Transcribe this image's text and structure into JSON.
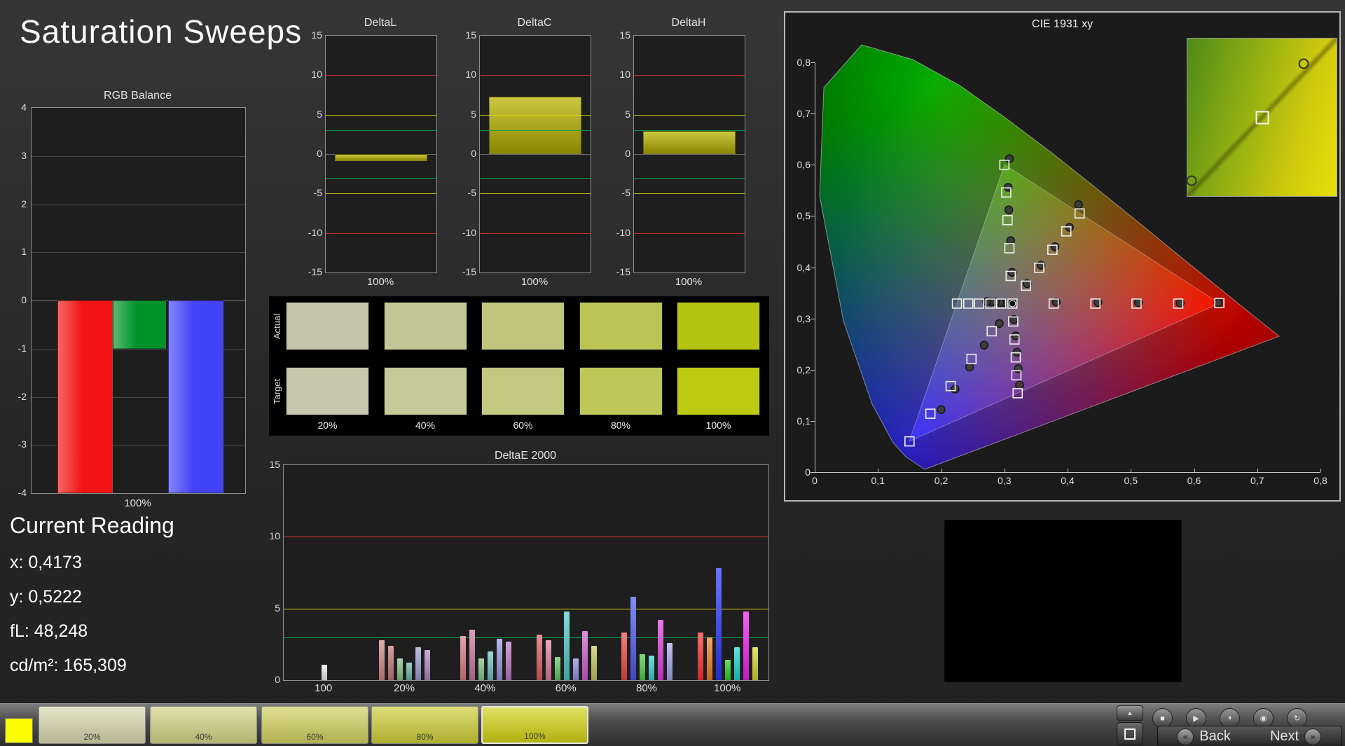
{
  "page": {
    "title": "Saturation Sweeps"
  },
  "rgb_balance": {
    "title": "RGB Balance",
    "xlabel": "100%",
    "ylim": [
      -4,
      4
    ],
    "yticks": [
      4,
      3,
      2,
      1,
      0,
      -1,
      -2,
      -3,
      -4
    ],
    "bars": [
      {
        "name": "red",
        "value": -4,
        "color": "#f21414"
      },
      {
        "name": "green",
        "value": -1,
        "color": "#00932a"
      },
      {
        "name": "blue",
        "value": -4,
        "color": "#4343fa"
      }
    ]
  },
  "delta_charts": {
    "ylim": [
      -15,
      15
    ],
    "yticks": [
      15,
      10,
      5,
      0,
      -5,
      -10,
      -15
    ],
    "xlabel": "100%",
    "bar_color": "#b9b400",
    "ref_lines": [
      {
        "v": 10,
        "color": "#e03232"
      },
      {
        "v": 5,
        "color": "#d6d600"
      },
      {
        "v": 3,
        "color": "#00a850"
      },
      {
        "v": -3,
        "color": "#00a850"
      },
      {
        "v": -5,
        "color": "#d6d600"
      },
      {
        "v": -10,
        "color": "#e03232"
      }
    ],
    "charts": [
      {
        "title": "DeltaL",
        "value": -0.9
      },
      {
        "title": "DeltaC",
        "value": 7.3
      },
      {
        "title": "DeltaH",
        "value": 2.9
      }
    ]
  },
  "swatch_table": {
    "row_labels": [
      "Actual",
      "Target"
    ],
    "columns": [
      "20%",
      "40%",
      "60%",
      "80%",
      "100%"
    ],
    "actual": [
      "#c3c4a9",
      "#c3c795",
      "#bfc67c",
      "#bcc553",
      "#b4c40f"
    ],
    "target": [
      "#c7c8ad",
      "#c6c999",
      "#c3c981",
      "#bfc757",
      "#bccb12"
    ]
  },
  "deltae": {
    "title": "DeltaE 2000",
    "ylim": [
      0,
      15
    ],
    "yticks": [
      15,
      10,
      5,
      0
    ],
    "ref_lines": [
      {
        "v": 10,
        "color": "#e03232"
      },
      {
        "v": 5,
        "color": "#d6d600"
      },
      {
        "v": 3,
        "color": "#00a850"
      }
    ],
    "groups": [
      {
        "label": "100",
        "bars": [
          {
            "color": "#f0f0f0",
            "value": 1.1
          }
        ]
      },
      {
        "label": "20%",
        "bars": [
          {
            "color": "#d4888c",
            "value": 2.8
          },
          {
            "color": "#c47878",
            "value": 2.4
          },
          {
            "color": "#8cc08c",
            "value": 1.5
          },
          {
            "color": "#70b8b0",
            "value": 1.2
          },
          {
            "color": "#a0a0d8",
            "value": 2.3
          },
          {
            "color": "#b888c0",
            "value": 2.1
          }
        ]
      },
      {
        "label": "40%",
        "bars": [
          {
            "color": "#d87e84",
            "value": 3.1
          },
          {
            "color": "#c877a0",
            "value": 3.5
          },
          {
            "color": "#84c884",
            "value": 1.5
          },
          {
            "color": "#6cc4c4",
            "value": 2.0
          },
          {
            "color": "#9898e0",
            "value": 2.9
          },
          {
            "color": "#c078c8",
            "value": 2.7
          }
        ]
      },
      {
        "label": "60%",
        "bars": [
          {
            "color": "#e06060",
            "value": 3.2
          },
          {
            "color": "#e080a0",
            "value": 2.8
          },
          {
            "color": "#60c860",
            "value": 1.6
          },
          {
            "color": "#50c8c8",
            "value": 4.8
          },
          {
            "color": "#9090e8",
            "value": 1.5
          },
          {
            "color": "#d060d0",
            "value": 3.4
          },
          {
            "color": "#c8c860",
            "value": 2.4
          }
        ]
      },
      {
        "label": "80%",
        "bars": [
          {
            "color": "#f04848",
            "value": 3.3
          },
          {
            "color": "#5058f0",
            "value": 5.8
          },
          {
            "color": "#48d048",
            "value": 1.8
          },
          {
            "color": "#40d0d0",
            "value": 1.7
          },
          {
            "color": "#e040e0",
            "value": 4.2
          },
          {
            "color": "#a8a8f0",
            "value": 2.6
          }
        ]
      },
      {
        "label": "100%",
        "bars": [
          {
            "color": "#ff3030",
            "value": 3.3
          },
          {
            "color": "#f08030",
            "value": 3.0
          },
          {
            "color": "#2838ff",
            "value": 7.8
          },
          {
            "color": "#28d028",
            "value": 1.4
          },
          {
            "color": "#20d8d8",
            "value": 2.3
          },
          {
            "color": "#f020f0",
            "value": 4.8
          },
          {
            "color": "#d8d830",
            "value": 2.3
          }
        ]
      }
    ]
  },
  "cie": {
    "title": "CIE 1931 xy",
    "xticks": [
      "0",
      "0,1",
      "0,2",
      "0,3",
      "0,4",
      "0,5",
      "0,6",
      "0,7",
      "0,8"
    ],
    "yticks": [
      "0,8",
      "0,7",
      "0,6",
      "0,5",
      "0,4",
      "0,3",
      "0,2",
      "0,1",
      "0"
    ],
    "triangle": [
      [
        0.64,
        0.33
      ],
      [
        0.3,
        0.6
      ],
      [
        0.15,
        0.06
      ]
    ],
    "targets": [
      [
        0.3127,
        0.329
      ],
      [
        0.378,
        0.329
      ],
      [
        0.444,
        0.329
      ],
      [
        0.509,
        0.329
      ],
      [
        0.575,
        0.329
      ],
      [
        0.64,
        0.33
      ],
      [
        0.31,
        0.383
      ],
      [
        0.308,
        0.437
      ],
      [
        0.305,
        0.492
      ],
      [
        0.303,
        0.546
      ],
      [
        0.3,
        0.6
      ],
      [
        0.28,
        0.275
      ],
      [
        0.248,
        0.221
      ],
      [
        0.215,
        0.168
      ],
      [
        0.183,
        0.114
      ],
      [
        0.15,
        0.06
      ],
      [
        0.295,
        0.329
      ],
      [
        0.278,
        0.329
      ],
      [
        0.26,
        0.329
      ],
      [
        0.243,
        0.329
      ],
      [
        0.225,
        0.329
      ],
      [
        0.314,
        0.294
      ],
      [
        0.316,
        0.259
      ],
      [
        0.318,
        0.224
      ],
      [
        0.319,
        0.189
      ],
      [
        0.321,
        0.154
      ],
      [
        0.334,
        0.364
      ],
      [
        0.355,
        0.399
      ],
      [
        0.376,
        0.434
      ],
      [
        0.398,
        0.47
      ],
      [
        0.419,
        0.505
      ]
    ],
    "measured": [
      [
        0.3135,
        0.331
      ],
      [
        0.382,
        0.332
      ],
      [
        0.448,
        0.331
      ],
      [
        0.512,
        0.331
      ],
      [
        0.578,
        0.33
      ],
      [
        0.638,
        0.331
      ],
      [
        0.312,
        0.39
      ],
      [
        0.31,
        0.452
      ],
      [
        0.307,
        0.512
      ],
      [
        0.306,
        0.556
      ],
      [
        0.308,
        0.612
      ],
      [
        0.292,
        0.29
      ],
      [
        0.268,
        0.248
      ],
      [
        0.245,
        0.205
      ],
      [
        0.222,
        0.162
      ],
      [
        0.2,
        0.122
      ],
      [
        0.3,
        0.331
      ],
      [
        0.293,
        0.331
      ],
      [
        0.286,
        0.332
      ],
      [
        0.279,
        0.332
      ],
      [
        0.272,
        0.333
      ],
      [
        0.315,
        0.298
      ],
      [
        0.318,
        0.266
      ],
      [
        0.32,
        0.234
      ],
      [
        0.322,
        0.202
      ],
      [
        0.324,
        0.17
      ],
      [
        0.336,
        0.368
      ],
      [
        0.358,
        0.404
      ],
      [
        0.38,
        0.44
      ],
      [
        0.403,
        0.478
      ],
      [
        0.4173,
        0.5222
      ]
    ],
    "current": [
      0.3127,
      0.329
    ]
  },
  "inset": {
    "markers": [
      {
        "type": "circle",
        "x": 0.78,
        "y": 0.16
      },
      {
        "type": "square",
        "x": 0.5,
        "y": 0.5
      },
      {
        "type": "circle",
        "x": 0.03,
        "y": 0.9
      }
    ]
  },
  "current_reading": {
    "title": "Current Reading",
    "lines": [
      "x: 0,4173",
      "y: 0,5222",
      "fL: 48,248",
      "cd/m²: 165,309"
    ]
  },
  "toolbar": {
    "stack": [
      {
        "name": "up",
        "glyph": "▲"
      }
    ],
    "row": [
      {
        "name": "stop",
        "glyph": "■"
      },
      {
        "name": "play",
        "glyph": "▶"
      },
      {
        "name": "pause",
        "glyph": "⏸"
      },
      {
        "name": "record",
        "glyph": "◉"
      },
      {
        "name": "refresh",
        "glyph": "↻"
      }
    ]
  },
  "bottom_bar": {
    "chip_color": "#fdfd02",
    "back": "Back",
    "next": "Next",
    "back_chevron": "«",
    "next_chevron": "»",
    "swatches": [
      {
        "label": "20%",
        "color": "#d6d6ac"
      },
      {
        "label": "40%",
        "color": "#d2d284"
      },
      {
        "label": "60%",
        "color": "#cfcf5c"
      },
      {
        "label": "80%",
        "color": "#cccc34"
      },
      {
        "label": "100%",
        "color": "#d0d010",
        "selected": true
      }
    ]
  }
}
